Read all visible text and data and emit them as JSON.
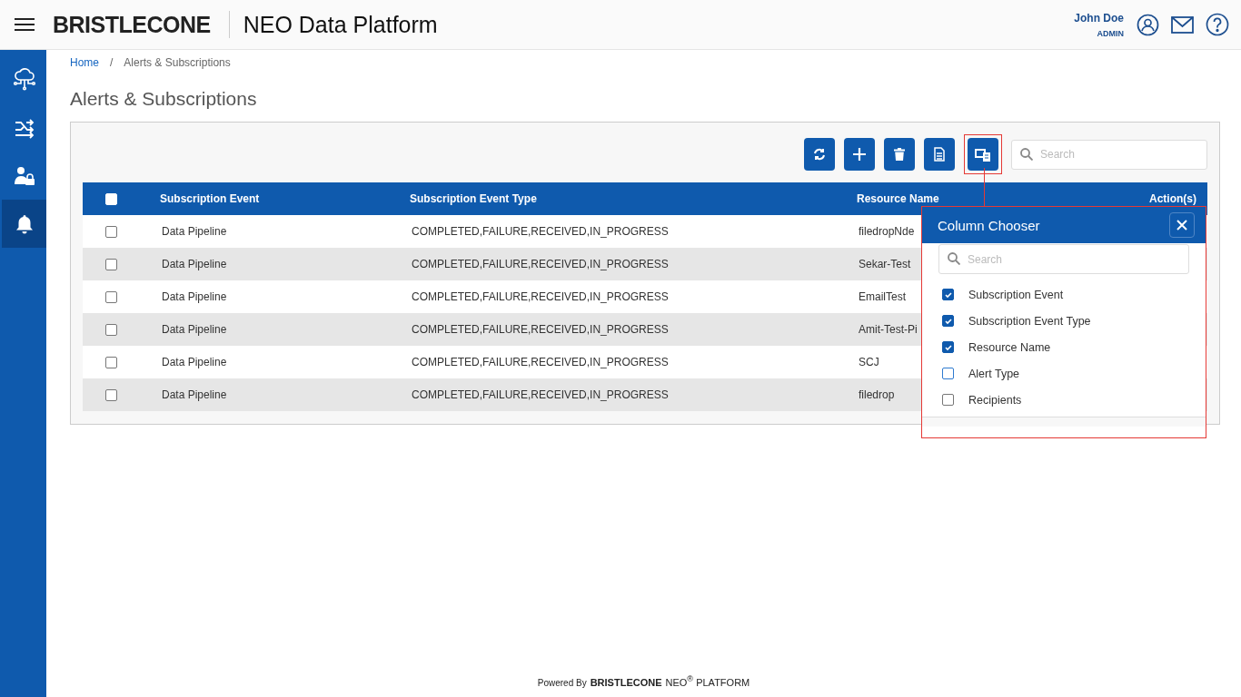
{
  "header": {
    "logo": "BRISTLECONE",
    "app_title": "NEO Data Platform",
    "user_name": "John Doe",
    "user_role": "ADMIN"
  },
  "sidebar": {
    "items": [
      {
        "kind": "cloud",
        "selected": false
      },
      {
        "kind": "shuffle",
        "selected": false
      },
      {
        "kind": "user-lock",
        "selected": false
      },
      {
        "kind": "bell",
        "selected": true
      }
    ]
  },
  "breadcrumb": {
    "separator": "/",
    "items": [
      "Home",
      "Alerts & Subscriptions"
    ]
  },
  "page_title": "Alerts & Subscriptions",
  "toolbar": {
    "buttons": [
      {
        "kind": "refresh"
      },
      {
        "kind": "add"
      },
      {
        "kind": "delete"
      },
      {
        "kind": "export"
      },
      {
        "kind": "columns",
        "highlighted": true
      }
    ],
    "search": {
      "placeholder": "Search"
    }
  },
  "table": {
    "select_all": {
      "checked": false
    },
    "columns": [
      "Subscription Event",
      "Subscription Event Type",
      "Resource Name",
      "Action(s)"
    ],
    "rows": [
      {
        "checked": false,
        "cells": [
          "Data Pipeline",
          "COMPLETED,FAILURE,RECEIVED,IN_PROGRESS",
          "filedropNde"
        ]
      },
      {
        "checked": false,
        "cells": [
          "Data Pipeline",
          "COMPLETED,FAILURE,RECEIVED,IN_PROGRESS",
          "Sekar-Test"
        ]
      },
      {
        "checked": false,
        "cells": [
          "Data Pipeline",
          "COMPLETED,FAILURE,RECEIVED,IN_PROGRESS",
          "EmailTest"
        ]
      },
      {
        "checked": false,
        "cells": [
          "Data Pipeline",
          "COMPLETED,FAILURE,RECEIVED,IN_PROGRESS",
          "Amit-Test-Pi"
        ]
      },
      {
        "checked": false,
        "cells": [
          "Data Pipeline",
          "COMPLETED,FAILURE,RECEIVED,IN_PROGRESS",
          "SCJ"
        ]
      },
      {
        "checked": false,
        "cells": [
          "Data Pipeline",
          "COMPLETED,FAILURE,RECEIVED,IN_PROGRESS",
          "filedrop"
        ]
      }
    ]
  },
  "column_chooser": {
    "title": "Column Chooser",
    "search": {
      "placeholder": "Search"
    },
    "items": [
      {
        "label": "Subscription Event",
        "checked": true
      },
      {
        "label": "Subscription Event Type",
        "checked": true
      },
      {
        "label": "Resource Name",
        "checked": true
      },
      {
        "label": "Alert Type",
        "checked": false
      },
      {
        "label": "Recipients",
        "checked": false
      }
    ]
  },
  "footer": {
    "powered_by": "Powered By",
    "logo": "BRISTLECONE",
    "platform": "NEO$^{®}$ PLATFORM"
  }
}
